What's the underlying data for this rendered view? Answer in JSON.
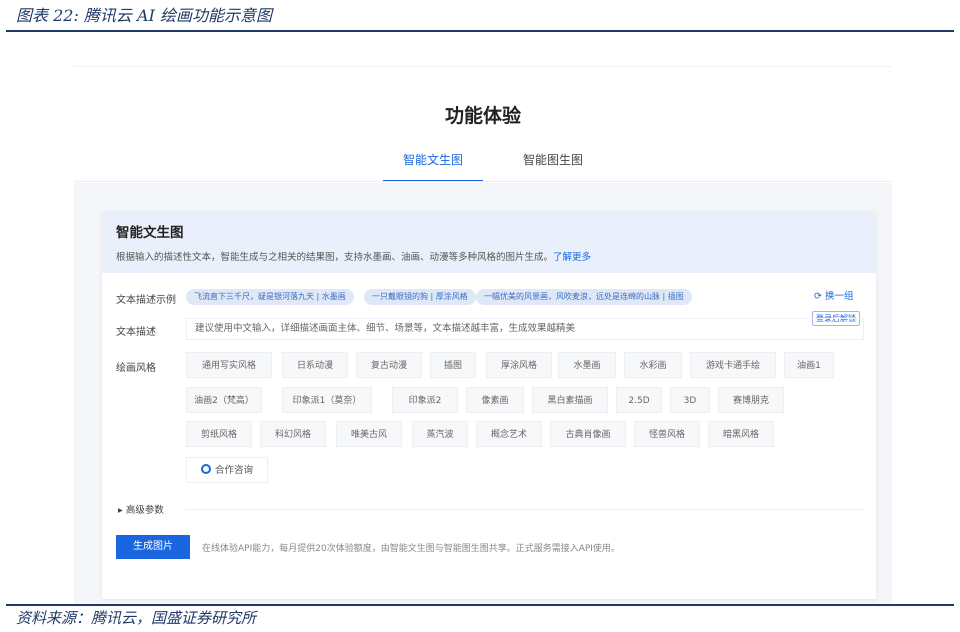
{
  "figure": {
    "caption": "图表 22:  腾讯云 AI 绘画功能示意图",
    "source": "资料来源：腾讯云，国盛证券研究所"
  },
  "page": {
    "title": "功能体验",
    "tabs": [
      {
        "label": "智能文生图",
        "active": true
      },
      {
        "label": "智能图生图",
        "active": false
      }
    ]
  },
  "card": {
    "title": "智能文生图",
    "desc": "根据输入的描述性文本，智能生成与之相关的结果图，支持水墨画、油画、动漫等多种风格的图片生成。",
    "more_link": "了解更多"
  },
  "examples": {
    "label": "文本描述示例",
    "chips": [
      "飞流直下三千尺，疑是银河落九天 | 水墨画",
      "一只戴眼镜的狗 | 厚涂风格",
      "一幅优美的风景画，风吹麦浪，远处是连绵的山脉 | 插图"
    ],
    "refresh_label": "换一组",
    "login_tag": "登录后解锁"
  },
  "text_input": {
    "label": "文本描述",
    "placeholder": "建议使用中文输入，详细描述画面主体、细节、场景等，文本描述越丰富，生成效果越精美"
  },
  "styles": {
    "label": "绘画风格",
    "rows": [
      [
        "通用写实风格",
        "日系动漫",
        "复古动漫",
        "插图",
        "厚涂风格",
        "水墨画",
        "水彩画",
        "游戏卡通手绘",
        "油画1"
      ],
      [
        "油画2（梵高）",
        "印象派1（莫奈）",
        "印象派2",
        "像素画",
        "黑白素描画",
        "2.5D",
        "3D",
        "赛博朋克"
      ],
      [
        "剪纸风格",
        "科幻风格",
        "唯美古风",
        "蒸汽波",
        "概念艺术",
        "古典肖像画",
        "怪兽风格",
        "暗黑风格"
      ]
    ],
    "consult_label": "合作咨询"
  },
  "advanced": {
    "label": "高级参数"
  },
  "generate": {
    "button_label": "生成图片",
    "note": "在线体验API能力，每月提供20次体验额度，由智能文生图与智能图生图共享。正式服务需接入API使用。"
  }
}
